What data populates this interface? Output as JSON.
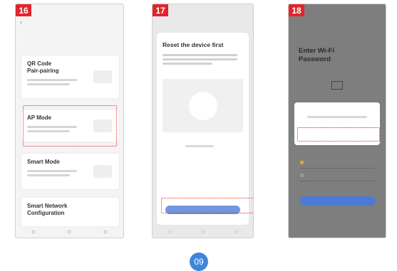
{
  "screen16": {
    "step": "16",
    "modes": [
      {
        "label": "QR Code\nPair-pairing"
      },
      {
        "label": "AP Mode"
      },
      {
        "label": "Smart Mode"
      },
      {
        "label": "Smart Network\nConfiguration"
      }
    ]
  },
  "screen17": {
    "step": "17",
    "heading": "Reset the device first"
  },
  "screen18": {
    "step": "18",
    "title": "Enter Wi-Fi\nPassword"
  },
  "page": {
    "number": "09"
  },
  "colors": {
    "badge": "#e3242b",
    "highlight": "#e3242b",
    "accent_blue": "#4b7ad6",
    "page_circle": "#3f86d9"
  }
}
